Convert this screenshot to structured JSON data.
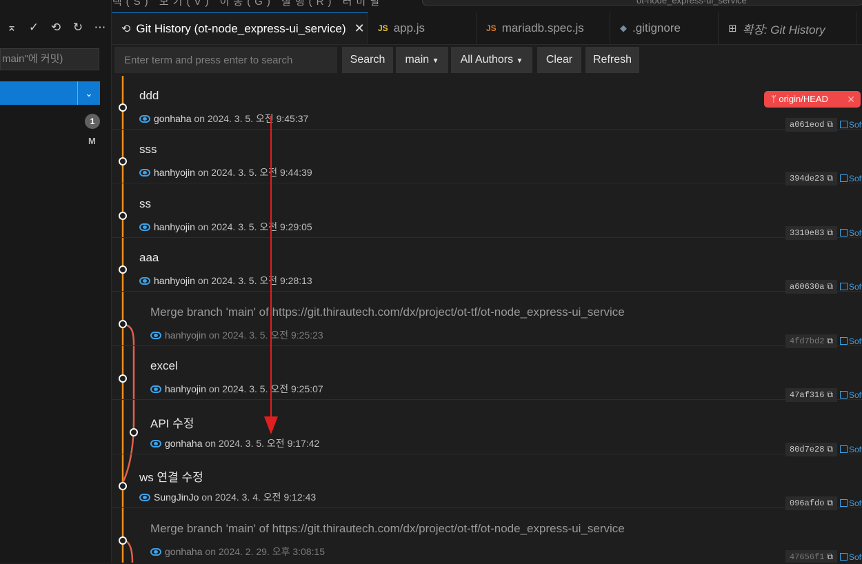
{
  "topbar": {
    "menu_text": "(F)  편집(E)  선택(S)  보기(V)  이동(G)  실행(R)  터미널",
    "title": "ot-node_express-ui_service"
  },
  "sidebar": {
    "commit_placeholder": "main\"에 커밋)",
    "badge_count": "1",
    "file_status": "M",
    "toolbar_icons": [
      "more-icon",
      "checkmark-icon",
      "history-icon",
      "refresh-icon",
      "ellipsis-icon"
    ]
  },
  "tabs": [
    {
      "label": "Git History (ot-node_express-ui_service)",
      "icon": "history-icon",
      "active": true
    },
    {
      "label": "app.js",
      "icon": "JS"
    },
    {
      "label": "mariadb.spec.js",
      "icon": "JS"
    },
    {
      "label": ".gitignore",
      "icon": "gitignore-icon"
    },
    {
      "label": "확장: Git History",
      "icon": "extensions-icon"
    }
  ],
  "search": {
    "placeholder": "Enter term and press enter to search",
    "search_label": "Search",
    "branch_label": "main",
    "authors_label": "All Authors",
    "clear_label": "Clear",
    "refresh_label": "Refresh"
  },
  "origin_head_label": "origin/HEAD",
  "commits": [
    {
      "message": "ddd",
      "author": "gonhaha",
      "date": "on 2024. 3. 5. 오전 9:45:37",
      "hash": "a061eod",
      "merge": false
    },
    {
      "message": "sss",
      "author": "hanhyojin",
      "date": "on 2024. 3. 5. 오전 9:44:39",
      "hash": "394de23",
      "merge": false
    },
    {
      "message": "ss",
      "author": "hanhyojin",
      "date": "on 2024. 3. 5. 오전 9:29:05",
      "hash": "3310e83",
      "merge": false
    },
    {
      "message": "aaa",
      "author": "hanhyojin",
      "date": "on 2024. 3. 5. 오전 9:28:13",
      "hash": "a60630a",
      "merge": false
    },
    {
      "message": "Merge branch 'main' of https://git.thirautech.com/dx/project/ot-tf/ot-node_express-ui_service",
      "author": "hanhyojin",
      "date": "on 2024. 3. 5. 오전 9:25:23",
      "hash": "4fd7bd2",
      "merge": true
    },
    {
      "message": "excel",
      "author": "hanhyojin",
      "date": "on 2024. 3. 5. 오전 9:25:07",
      "hash": "47af316",
      "merge": false
    },
    {
      "message": "API 수정",
      "author": "gonhaha",
      "date": "on 2024. 3. 5. 오전 9:17:42",
      "hash": "80d7e28",
      "merge": false
    },
    {
      "message": "ws 연결 수정",
      "author": "SungJinJo",
      "date": "on 2024. 3. 4. 오전 9:12:43",
      "hash": "096afdo",
      "merge": false
    },
    {
      "message": "Merge branch 'main' of https://git.thirautech.com/dx/project/ot-tf/ot-node_express-ui_service",
      "author": "gonhaha",
      "date": "on 2024. 2. 29. 오후 3:08:15",
      "hash": "47656f1",
      "merge": true
    }
  ],
  "soft_label": "Soft",
  "colors": {
    "accent": "#0e7ad3",
    "graph_main": "#f0901e",
    "graph_branch": "#e0604a",
    "origin_badge": "#f04848",
    "annotation_arrow": "#e02020"
  }
}
